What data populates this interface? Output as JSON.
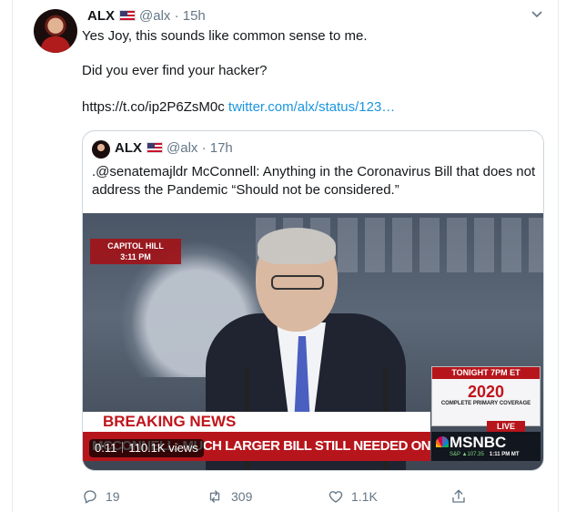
{
  "tweet": {
    "author_name": "ALX",
    "author_handle": "@alx",
    "separator": "·",
    "time": "15h",
    "line1": "Yes Joy, this sounds like common sense to me.",
    "line2": "Did you ever find your hacker?",
    "link_plain": "https://t.co/ip2P6ZsM0c",
    "link_url": "twitter.com/alx/status/123…"
  },
  "quoted": {
    "author_name": "ALX",
    "author_handle": "@alx",
    "separator": "·",
    "time": "17h",
    "text_line1": ".@senatemajldr McConnell: Anything in the Coronavirus Bill that does not",
    "text_line2": "address the Pandemic “Should not be considered.”",
    "video": {
      "location": "CAPITOL HILL",
      "location_time": "3:11 PM",
      "breaking": "BREAKING NEWS",
      "headline": "MCCONNELL: MUCH LARGER BILL STILL NEEDED ON CORONAVIRUS",
      "promo_top": "TONIGHT 7PM ET",
      "promo_logo": "2020",
      "promo_sub": "COMPLETE PRIMARY COVERAGE",
      "live": "LIVE",
      "network": "MSNBC",
      "ticker": "S&P ▲107.35",
      "ticker_time": "1:11 PM MT",
      "duration": "0:11",
      "views": "110.1K views"
    }
  },
  "actions": {
    "replies": "19",
    "retweets": "309",
    "likes": "1.1K"
  },
  "colors": {
    "link": "#1b95e0",
    "muted": "#657786",
    "border": "#ccd6dd"
  },
  "icons": [
    "chevron-down-icon",
    "reply-icon",
    "retweet-icon",
    "like-icon",
    "share-icon",
    "us-flag-icon"
  ]
}
